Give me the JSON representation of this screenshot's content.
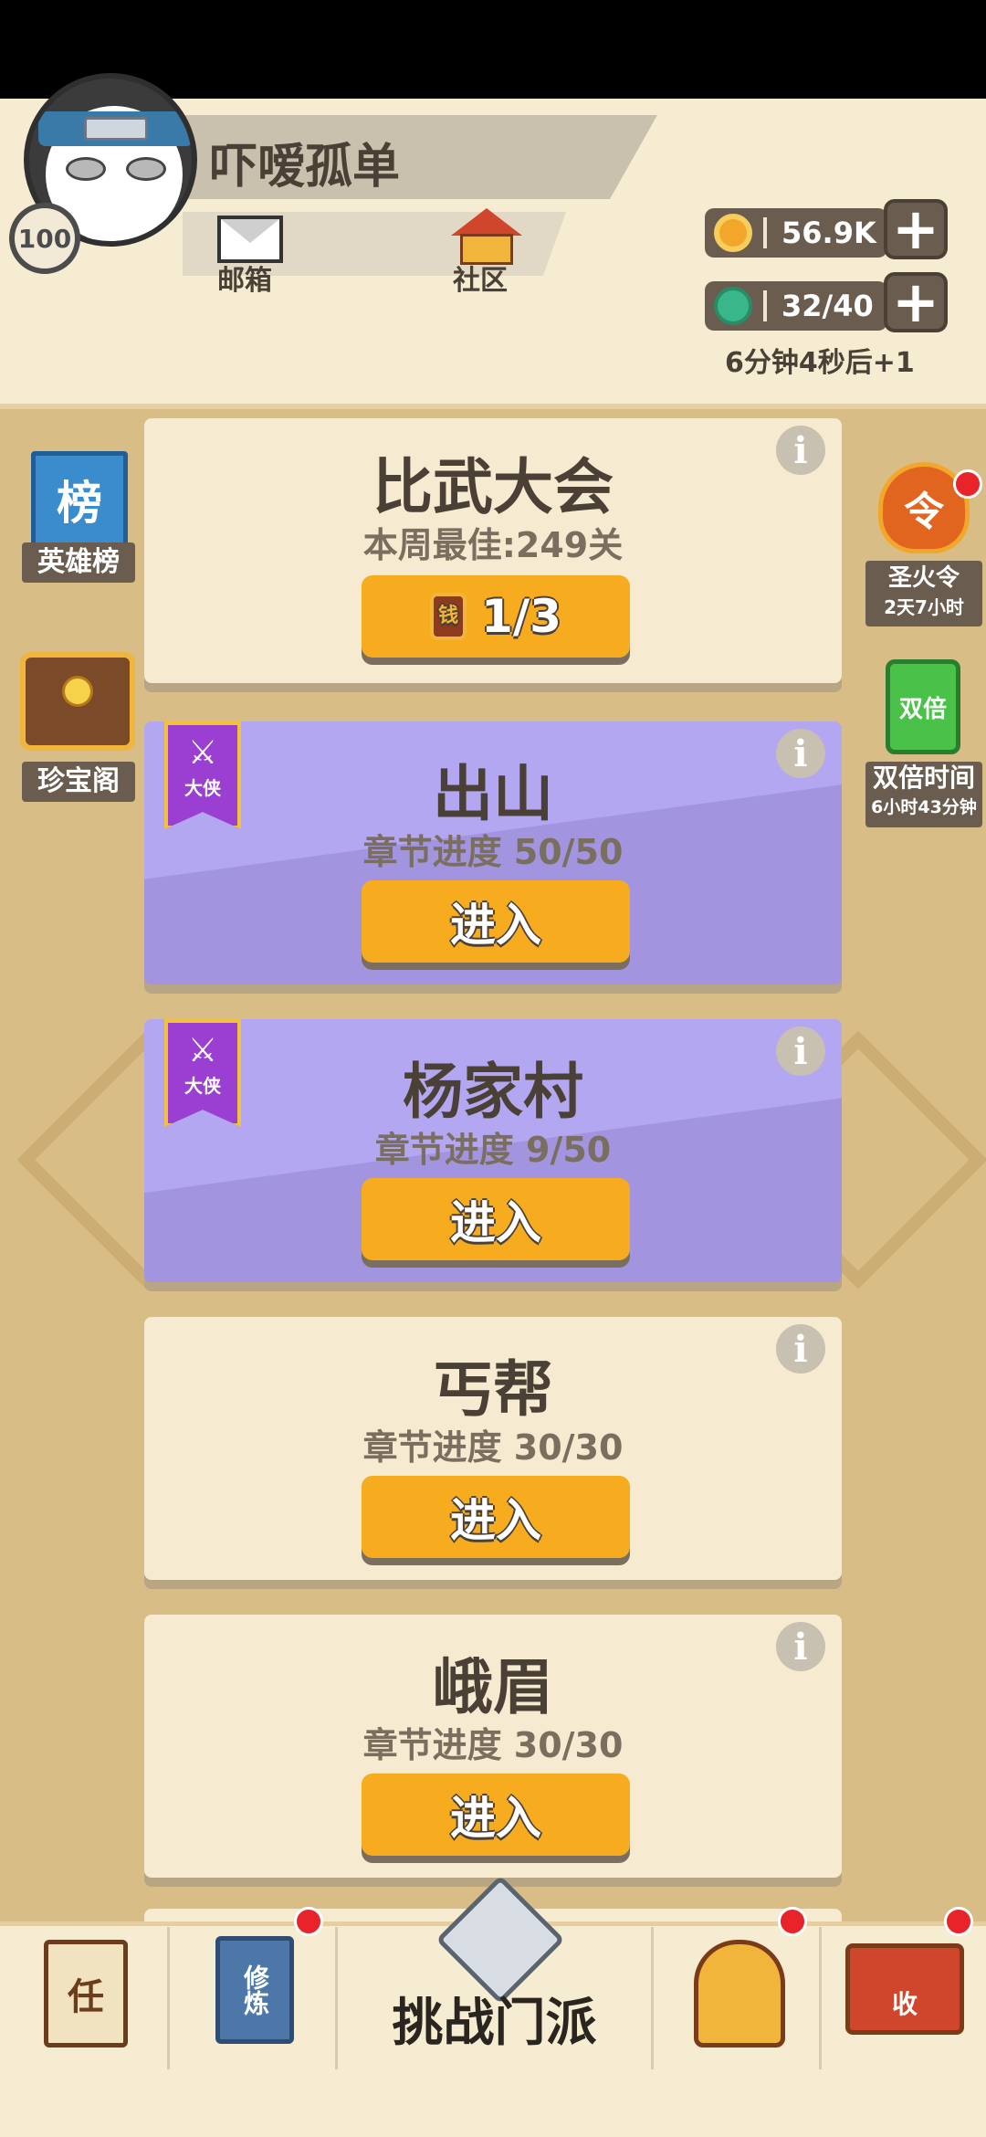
{
  "player": {
    "name": "吓嗳孤单",
    "level": "100"
  },
  "header": {
    "mail_label": "邮箱",
    "community_label": "社区"
  },
  "resources": {
    "gold": "56.9K",
    "gems": "32/40",
    "regen_timer": "6分钟4秒后+1"
  },
  "left_side": {
    "leaderboard": {
      "icon_text": "榜",
      "label": "英雄榜"
    },
    "treasure": {
      "label": "珍宝阁"
    }
  },
  "right_side": {
    "fire_token": {
      "icon_text": "令",
      "label": "圣火令",
      "time": "2天7小时"
    },
    "double": {
      "icon_text": "双倍",
      "label": "双倍时间",
      "time": "6小时43分钟"
    }
  },
  "cards": [
    {
      "title": "比武大会",
      "subtitle": "本周最佳:249关",
      "button": "1/3",
      "token_text": "钱"
    },
    {
      "title": "出山",
      "subtitle": "章节进度 50/50",
      "button": "进入",
      "badge": "大侠"
    },
    {
      "title": "杨家村",
      "subtitle": "章节进度 9/50",
      "button": "进入",
      "badge": "大侠"
    },
    {
      "title": "丐帮",
      "subtitle": "章节进度 30/30",
      "button": "进入"
    },
    {
      "title": "峨眉",
      "subtitle": "章节进度 30/30",
      "button": "进入"
    }
  ],
  "bottom_nav": {
    "tasks_icon_text": "任",
    "training_icon_text": "修炼",
    "main_label": "挑战门派",
    "shop_icon_text": "收"
  },
  "colors": {
    "button": "#f7ab1f",
    "purple_card": "#a294df",
    "cream_card": "#f6ebd0",
    "badge": "#e8242a"
  }
}
